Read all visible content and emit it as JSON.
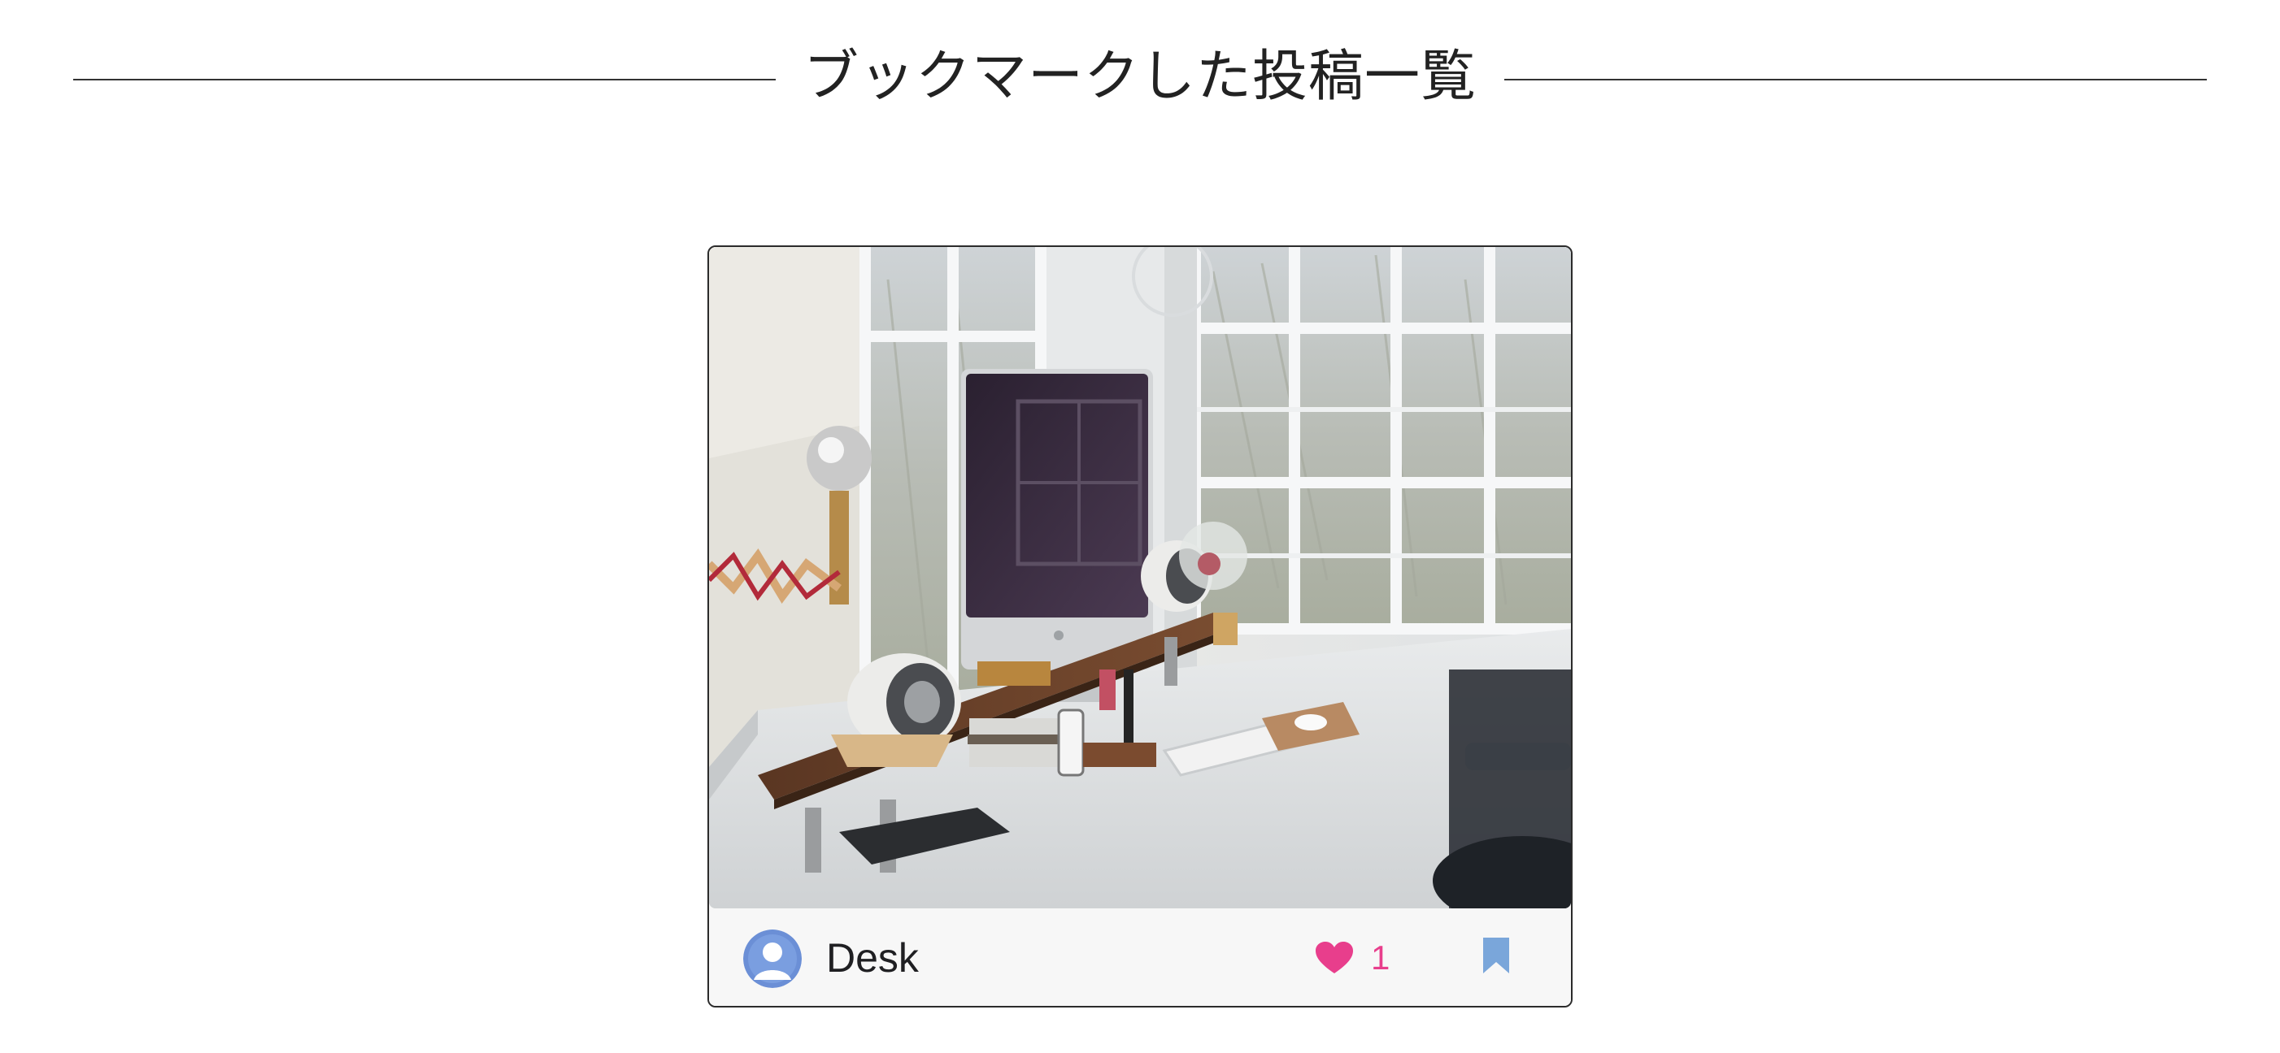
{
  "page": {
    "heading": "ブックマークした投稿一覧"
  },
  "posts": [
    {
      "title": "Desk",
      "image_alt": "desk with iMac, speakers and lamp by window",
      "avatar_icon": "user-avatar-icon",
      "like_icon": "heart-icon",
      "like_count": "1",
      "bookmark_icon": "bookmark-icon",
      "colors": {
        "like": "#e83e8c",
        "bookmark": "#7aa6da",
        "avatar": "#6b8fd6"
      }
    }
  ]
}
